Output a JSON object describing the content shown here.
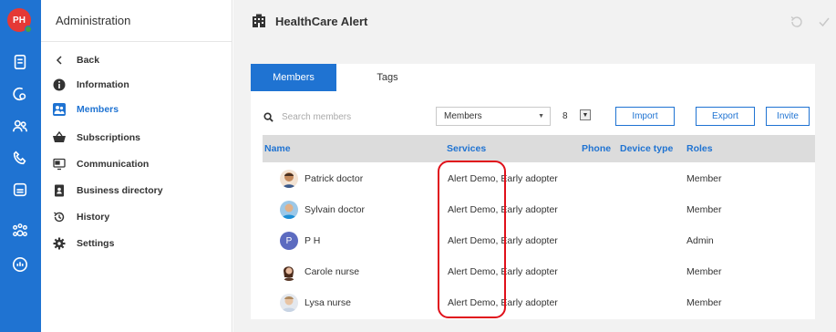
{
  "rail": {
    "avatar_initials": "PH",
    "icons": [
      "document-icon",
      "phone-link-icon",
      "users-icon",
      "phone-call-icon",
      "news-icon",
      "group-icon",
      "broadcast-icon"
    ]
  },
  "sidebar": {
    "title": "Administration",
    "items": [
      {
        "label": "Back",
        "icon": "chevron-left-icon"
      },
      {
        "label": "Information",
        "icon": "info-icon"
      },
      {
        "label": "Members",
        "icon": "members-icon",
        "active": true
      },
      {
        "label": "Subscriptions",
        "icon": "cart-icon"
      },
      {
        "label": "Communication",
        "icon": "monitor-chat-icon"
      },
      {
        "label": "Business directory",
        "icon": "contacts-book-icon"
      },
      {
        "label": "History",
        "icon": "history-icon"
      },
      {
        "label": "Settings",
        "icon": "gear-icon"
      }
    ]
  },
  "main": {
    "title": "HealthCare Alert",
    "tabs": [
      {
        "label": "Members"
      },
      {
        "label": "Tags"
      }
    ],
    "search_placeholder": "Search members",
    "filter_value": "Members",
    "page_size": "8",
    "buttons": {
      "import": "Import",
      "export": "Export",
      "invite": "Invite"
    },
    "columns": {
      "name": "Name",
      "services": "Services",
      "phone": "Phone",
      "device_type": "Device type",
      "roles": "Roles"
    },
    "rows": [
      {
        "name": "Patrick doctor",
        "services": "Alert Demo, Early adopter",
        "phone": "",
        "device_type": "",
        "role": "Member"
      },
      {
        "name": "Sylvain doctor",
        "services": "Alert Demo, Early adopter",
        "phone": "",
        "device_type": "",
        "role": "Member"
      },
      {
        "name": "P H",
        "services": "Alert Demo, Early adopter",
        "phone": "",
        "device_type": "",
        "role": "Admin",
        "initial": "P"
      },
      {
        "name": "Carole nurse",
        "services": "Alert Demo, Early adopter",
        "phone": "",
        "device_type": "",
        "role": "Member"
      },
      {
        "name": "Lysa nurse",
        "services": "Alert Demo, Early adopter",
        "phone": "",
        "device_type": "",
        "role": "Member"
      }
    ]
  },
  "colors": {
    "accent": "#1f73d2",
    "highlight": "#e0101a",
    "avatar": "#e53935",
    "presence": "#43a047"
  }
}
